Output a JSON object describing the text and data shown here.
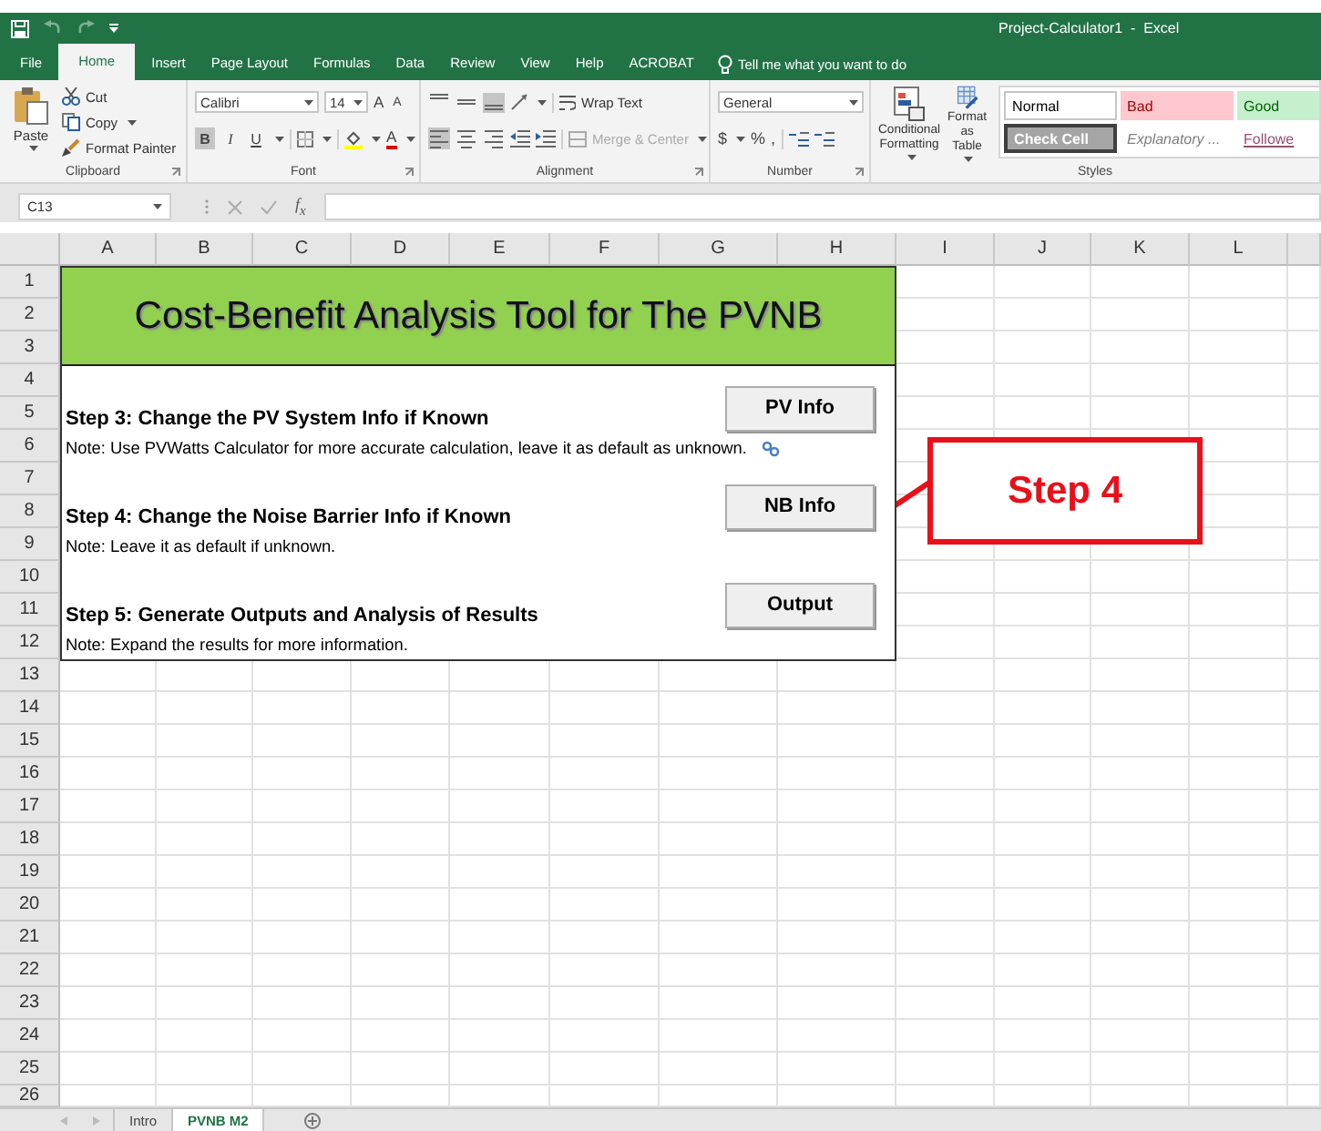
{
  "window": {
    "title": "Project-Calculator1  -  Excel"
  },
  "ribbon_tabs": [
    {
      "label": "File",
      "selected": false
    },
    {
      "label": "Home",
      "selected": true
    },
    {
      "label": "Insert",
      "selected": false
    },
    {
      "label": "Page Layout",
      "selected": false
    },
    {
      "label": "Formulas",
      "selected": false
    },
    {
      "label": "Data",
      "selected": false
    },
    {
      "label": "Review",
      "selected": false
    },
    {
      "label": "View",
      "selected": false
    },
    {
      "label": "Help",
      "selected": false
    },
    {
      "label": "ACROBAT",
      "selected": false
    }
  ],
  "tell_me": {
    "placeholder": "Tell me what you want to do"
  },
  "clipboard": {
    "label": "Clipboard",
    "paste": "Paste",
    "cut": "Cut",
    "copy": "Copy",
    "format_painter": "Format Painter"
  },
  "font": {
    "label": "Font",
    "font_name": "Calibri",
    "font_size": "14",
    "grow": "A",
    "shrink": "A",
    "bold": "B",
    "bold_active": true,
    "italic": "I",
    "underline": "U",
    "font_color": "A"
  },
  "alignment": {
    "label": "Alignment",
    "wrap_text": "Wrap Text",
    "merge": "Merge & Center",
    "vertical_align": [
      {
        "selected": false
      },
      {
        "selected": false
      },
      {
        "selected": true
      }
    ],
    "horizontal_align": [
      {
        "selected": true
      },
      {
        "selected": false
      },
      {
        "selected": false
      }
    ]
  },
  "number": {
    "label": "Number",
    "format": "General",
    "currency": "$",
    "percent": "%",
    "comma": ","
  },
  "styles": {
    "label": "Styles",
    "conditional": "Conditional Formatting",
    "format_table": "Format as Table",
    "cell_styles": [
      {
        "label": "Normal",
        "kind": "normal"
      },
      {
        "label": "Bad",
        "kind": "bad"
      },
      {
        "label": "Good",
        "kind": "good"
      },
      {
        "label": "Check Cell",
        "kind": "check"
      },
      {
        "label": "Explanatory ...",
        "kind": "explanatory"
      },
      {
        "label": "Followe",
        "kind": "followed"
      }
    ]
  },
  "formula_bar": {
    "name_box": "C13",
    "fx": "f$_{x}$"
  },
  "columns": [
    "A",
    "B",
    "C",
    "D",
    "E",
    "F",
    "G",
    "H",
    "I",
    "J",
    "K",
    "L"
  ],
  "rows": [
    "1",
    "2",
    "3",
    "4",
    "5",
    "6",
    "7",
    "8",
    "9",
    "10",
    "11",
    "12",
    "13",
    "14",
    "15",
    "16",
    "17",
    "18",
    "19",
    "20",
    "21",
    "22",
    "23",
    "24",
    "25",
    "26"
  ],
  "panel": {
    "title": "Cost-Benefit Analysis Tool for The PVNB",
    "steps": [
      {
        "heading": "Step 3: Change the PV System Info if Known",
        "note": "Note: Use PVWatts Calculator for more accurate calculation, leave it as default as unknown.",
        "button": "PV Info",
        "has_link": true
      },
      {
        "heading": "Step 4: Change the Noise Barrier Info if Known",
        "note": "Note: Leave it as default if unknown.",
        "button": "NB Info"
      },
      {
        "heading": "Step 5: Generate Outputs and Analysis of Results",
        "note": "Note: Expand the results for more information.",
        "button": "Output"
      }
    ]
  },
  "callout": {
    "label": "Step 4"
  },
  "sheet_tabs": [
    {
      "label": "Intro",
      "selected": false
    },
    {
      "label": "PVNB M2",
      "selected": true
    }
  ]
}
